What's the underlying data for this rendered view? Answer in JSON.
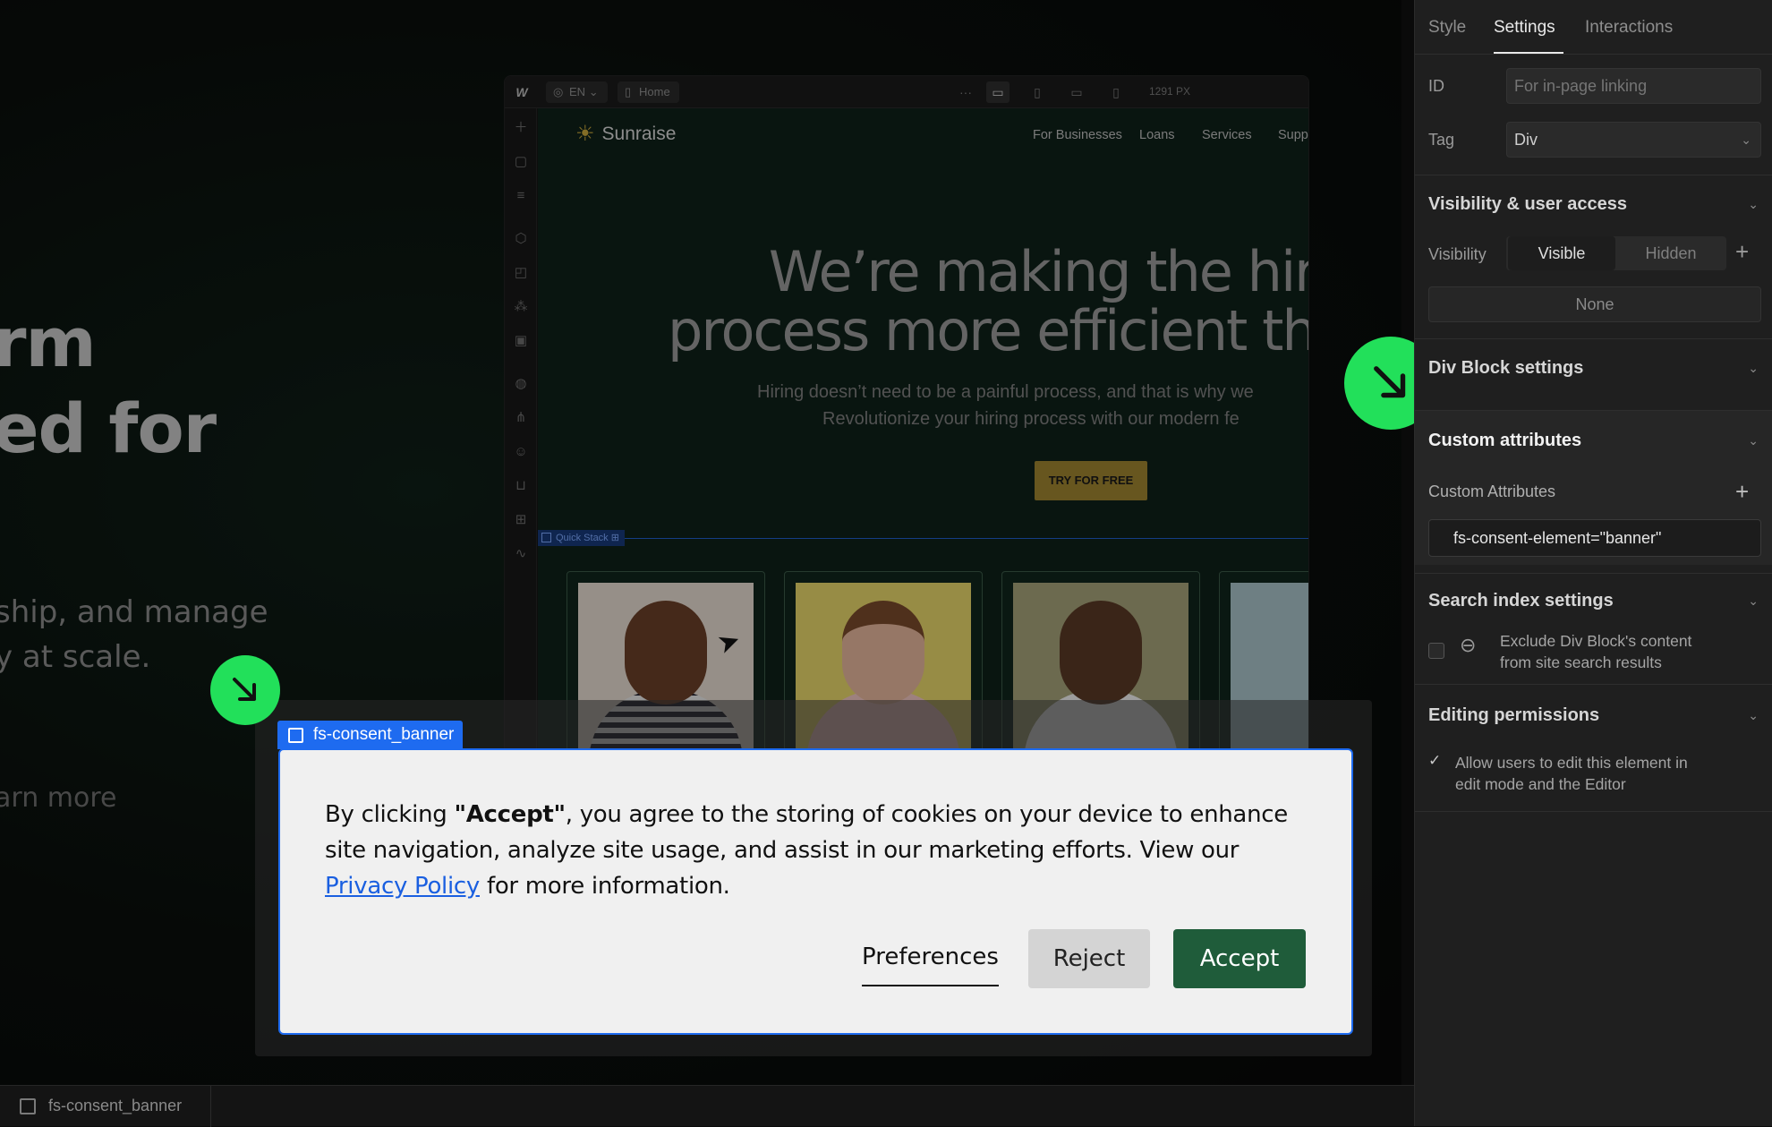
{
  "background_site": {
    "headline_lines": [
      "rm",
      "ed for"
    ],
    "paragraph_lines": [
      "ship, and manage",
      "y at scale."
    ],
    "learn_more": "arn more"
  },
  "designer": {
    "locale_label": "EN",
    "page_label": "Home",
    "width_label": "1291 PX",
    "site": {
      "brand": "Sunraise",
      "nav": [
        "For Businesses",
        "Loans",
        "Services",
        "Supp"
      ],
      "headline_line1": "We’re making the hir",
      "headline_line2": "process more efficient th",
      "sub_line1": "Hiring doesn’t need to be a painful process, and that is why we",
      "sub_line2": "Revolutionize your hiring process with our modern fe",
      "cta": "TRY FOR FREE",
      "quick_stack_label": "Quick Stack"
    }
  },
  "banner": {
    "tag_label": "fs-consent_banner",
    "text_part1": "By clicking ",
    "text_bold": "\"Accept\"",
    "text_part2": ", you agree to the storing of cookies on your device to enhance site navigation, analyze site usage, and assist in our marketing efforts. View our ",
    "privacy_link": "Privacy Policy",
    "text_part3": " for more information.",
    "preferences_label": "Preferences",
    "reject_label": "Reject",
    "accept_label": "Accept"
  },
  "panel": {
    "tabs": [
      "Style",
      "Settings",
      "Interactions"
    ],
    "active_tab": "Settings",
    "id_label": "ID",
    "id_placeholder": "For in-page linking",
    "tag_label": "Tag",
    "tag_value": "Div",
    "visibility_section": "Visibility & user access",
    "visibility_label": "Visibility",
    "visible_option": "Visible",
    "hidden_option": "Hidden",
    "none_option": "None",
    "div_block_section": "Div Block settings",
    "custom_attr_section": "Custom attributes",
    "custom_attr_label": "Custom Attributes",
    "custom_attr_value": "fs-consent-element=\"banner\"",
    "search_section": "Search index settings",
    "search_exclude_line1": "Exclude Div Block's content",
    "search_exclude_line2": "from site search results",
    "editing_section": "Editing permissions",
    "editing_line1": "Allow users to edit this element in",
    "editing_line2": "edit mode and the Editor"
  },
  "breadcrumb": {
    "item": "fs-consent_banner"
  },
  "colors": {
    "accent_green": "#22e05a",
    "selection_blue": "#1e6bf0",
    "accept_green": "#1f5c3a",
    "cta_gold": "#9e8430"
  }
}
